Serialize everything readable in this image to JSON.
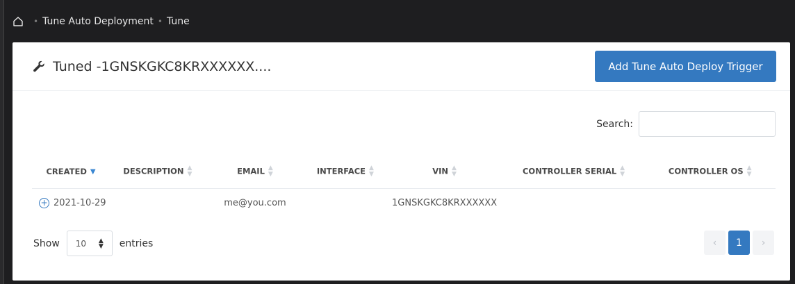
{
  "breadcrumb": {
    "items": [
      "Tune Auto Deployment",
      "Tune"
    ],
    "separator": "•"
  },
  "card": {
    "title": "Tuned -1GNSKGKC8KRXXXXXX....",
    "add_button_label": "Add Tune Auto Deploy Trigger"
  },
  "search": {
    "label": "Search:",
    "value": ""
  },
  "table": {
    "columns": [
      "CREATED",
      "DESCRIPTION",
      "EMAIL",
      "INTERFACE",
      "VIN",
      "CONTROLLER SERIAL",
      "CONTROLLER OS"
    ],
    "rows": [
      {
        "created": "2021-10-29",
        "description": "",
        "email": "me@you.com",
        "interface": "",
        "vin": "1GNSKGKC8KRXXXXXX",
        "controller_serial": "",
        "controller_os": ""
      }
    ]
  },
  "footer": {
    "show_label": "Show",
    "entries_value": "10",
    "entries_label": "entries"
  },
  "pagination": {
    "prev": "‹",
    "current": "1",
    "next": "›"
  },
  "colors": {
    "accent": "#3479c0",
    "topbar": "#1e1e20"
  }
}
